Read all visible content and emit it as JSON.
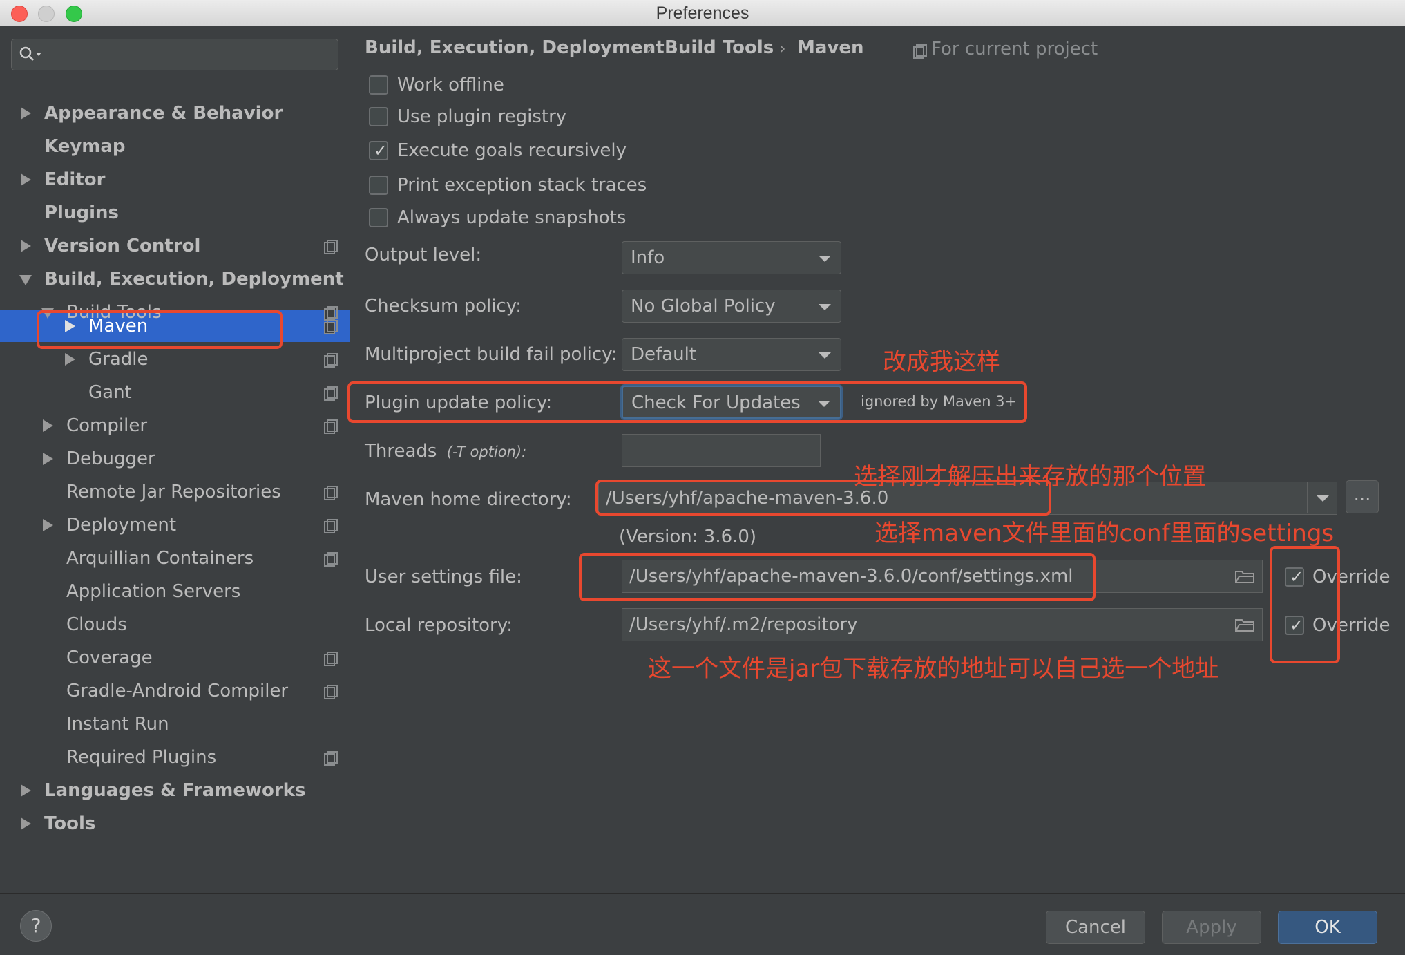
{
  "window": {
    "title": "Preferences"
  },
  "sidebar": {
    "search_placeholder": "",
    "items": [
      {
        "label": "Appearance & Behavior"
      },
      {
        "label": "Keymap"
      },
      {
        "label": "Editor"
      },
      {
        "label": "Plugins"
      },
      {
        "label": "Version Control"
      },
      {
        "label": "Build, Execution, Deployment"
      },
      {
        "label": "Build Tools"
      },
      {
        "label": "Maven"
      },
      {
        "label": "Gradle"
      },
      {
        "label": "Gant"
      },
      {
        "label": "Compiler"
      },
      {
        "label": "Debugger"
      },
      {
        "label": "Remote Jar Repositories"
      },
      {
        "label": "Deployment"
      },
      {
        "label": "Arquillian Containers"
      },
      {
        "label": "Application Servers"
      },
      {
        "label": "Clouds"
      },
      {
        "label": "Coverage"
      },
      {
        "label": "Gradle-Android Compiler"
      },
      {
        "label": "Instant Run"
      },
      {
        "label": "Required Plugins"
      },
      {
        "label": "Languages & Frameworks"
      },
      {
        "label": "Tools"
      }
    ]
  },
  "breadcrumb": {
    "items": [
      "Build, Execution, Deployment",
      "Build Tools",
      "Maven"
    ],
    "separator": "›",
    "scope": "For current project"
  },
  "options": {
    "work_offline": {
      "label": "Work offline",
      "checked": false
    },
    "use_plugin_registry": {
      "label": "Use plugin registry",
      "checked": false
    },
    "execute_goals_recursively": {
      "label": "Execute goals recursively",
      "checked": true
    },
    "print_exception_stack_traces": {
      "label": "Print exception stack traces",
      "checked": false
    },
    "always_update_snapshots": {
      "label": "Always update snapshots",
      "checked": false
    }
  },
  "form": {
    "output_level": {
      "label": "Output level:",
      "value": "Info"
    },
    "checksum_policy": {
      "label": "Checksum policy:",
      "value": "No Global Policy"
    },
    "multiproject_fail_policy": {
      "label": "Multiproject build fail policy:",
      "value": "Default"
    },
    "plugin_update_policy": {
      "label": "Plugin update policy:",
      "value": "Check For Updates",
      "hint": "ignored by Maven 3+"
    },
    "threads": {
      "label": "Threads",
      "sub_label": "(-T option):",
      "value": ""
    },
    "maven_home": {
      "label": "Maven home directory:",
      "value": "/Users/yhf/apache-maven-3.6.0",
      "version": "(Version: 3.6.0)",
      "browse": "..."
    },
    "user_settings": {
      "label": "User settings file:",
      "value": "/Users/yhf/apache-maven-3.6.0/conf/settings.xml",
      "override_label": "Override",
      "override": true
    },
    "local_repository": {
      "label": "Local repository:",
      "value": "/Users/yhf/.m2/repository",
      "override_label": "Override",
      "override": true
    }
  },
  "annotations": {
    "change_like_me": "改成我这样",
    "choose_unzip_location": "选择刚才解压出来存放的那个位置",
    "choose_settings": "选择maven文件里面的conf里面的settings",
    "jar_location": "这一个文件是jar包下载存放的地址可以自己选一个地址"
  },
  "buttons": {
    "help": "?",
    "cancel": "Cancel",
    "apply": "Apply",
    "ok": "OK"
  },
  "colors": {
    "background": "#3c3f41",
    "selection": "#2f65ca",
    "annotation": "#e8482f",
    "primary_button": "#365880"
  }
}
